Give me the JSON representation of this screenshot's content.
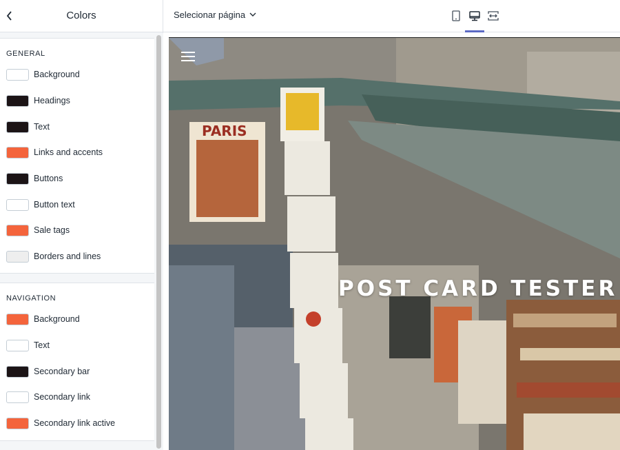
{
  "sidebar": {
    "title": "Colors",
    "general": {
      "heading": "GENERAL",
      "items": [
        {
          "label": "Background",
          "color": "#ffffff"
        },
        {
          "label": "Headings",
          "color": "#1c1416"
        },
        {
          "label": "Text",
          "color": "#1c1416"
        },
        {
          "label": "Links and accents",
          "color": "#f4643c"
        },
        {
          "label": "Buttons",
          "color": "#1c1416"
        },
        {
          "label": "Button text",
          "color": "#ffffff"
        },
        {
          "label": "Sale tags",
          "color": "#f4643c"
        },
        {
          "label": "Borders and lines",
          "color": "#eeeeee"
        }
      ]
    },
    "navigation": {
      "heading": "NAVIGATION",
      "items": [
        {
          "label": "Background",
          "color": "#f4643c"
        },
        {
          "label": "Text",
          "color": "#ffffff"
        },
        {
          "label": "Secondary bar",
          "color": "#1c1416"
        },
        {
          "label": "Secondary link",
          "color": "#ffffff"
        },
        {
          "label": "Secondary link active",
          "color": "#f4643c"
        }
      ]
    }
  },
  "topbar": {
    "page_select": "Selecionar página",
    "devices": [
      "mobile-icon",
      "desktop-icon",
      "fullscreen-icon"
    ],
    "active_device": "desktop-icon",
    "accent": "#5c6ac4"
  },
  "preview": {
    "hero_title": "POST CARD TESTER",
    "menu_icon": "hamburger-icon"
  }
}
